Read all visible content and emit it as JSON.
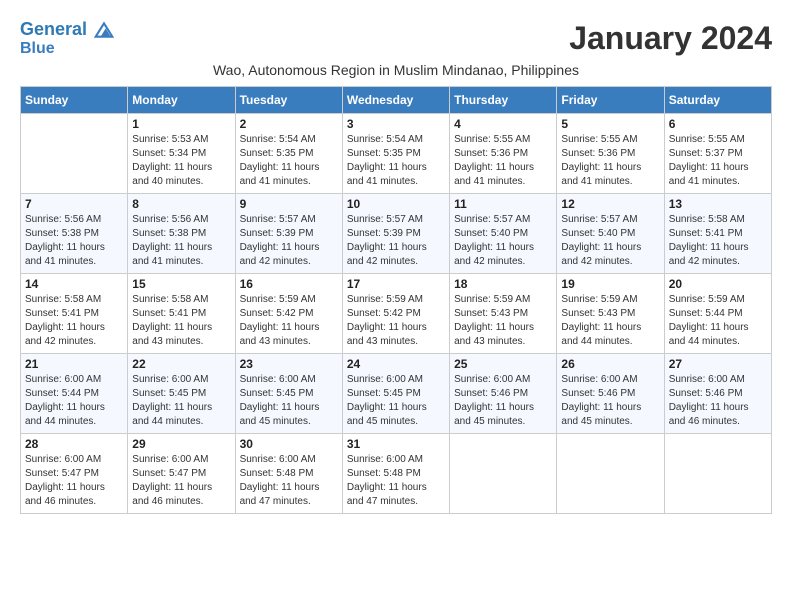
{
  "logo": {
    "line1": "General",
    "line2": "Blue"
  },
  "month_title": "January 2024",
  "subtitle": "Wao, Autonomous Region in Muslim Mindanao, Philippines",
  "weekdays": [
    "Sunday",
    "Monday",
    "Tuesday",
    "Wednesday",
    "Thursday",
    "Friday",
    "Saturday"
  ],
  "weeks": [
    [
      {
        "day": "",
        "info": ""
      },
      {
        "day": "1",
        "info": "Sunrise: 5:53 AM\nSunset: 5:34 PM\nDaylight: 11 hours\nand 40 minutes."
      },
      {
        "day": "2",
        "info": "Sunrise: 5:54 AM\nSunset: 5:35 PM\nDaylight: 11 hours\nand 41 minutes."
      },
      {
        "day": "3",
        "info": "Sunrise: 5:54 AM\nSunset: 5:35 PM\nDaylight: 11 hours\nand 41 minutes."
      },
      {
        "day": "4",
        "info": "Sunrise: 5:55 AM\nSunset: 5:36 PM\nDaylight: 11 hours\nand 41 minutes."
      },
      {
        "day": "5",
        "info": "Sunrise: 5:55 AM\nSunset: 5:36 PM\nDaylight: 11 hours\nand 41 minutes."
      },
      {
        "day": "6",
        "info": "Sunrise: 5:55 AM\nSunset: 5:37 PM\nDaylight: 11 hours\nand 41 minutes."
      }
    ],
    [
      {
        "day": "7",
        "info": "Sunrise: 5:56 AM\nSunset: 5:38 PM\nDaylight: 11 hours\nand 41 minutes."
      },
      {
        "day": "8",
        "info": "Sunrise: 5:56 AM\nSunset: 5:38 PM\nDaylight: 11 hours\nand 41 minutes."
      },
      {
        "day": "9",
        "info": "Sunrise: 5:57 AM\nSunset: 5:39 PM\nDaylight: 11 hours\nand 42 minutes."
      },
      {
        "day": "10",
        "info": "Sunrise: 5:57 AM\nSunset: 5:39 PM\nDaylight: 11 hours\nand 42 minutes."
      },
      {
        "day": "11",
        "info": "Sunrise: 5:57 AM\nSunset: 5:40 PM\nDaylight: 11 hours\nand 42 minutes."
      },
      {
        "day": "12",
        "info": "Sunrise: 5:57 AM\nSunset: 5:40 PM\nDaylight: 11 hours\nand 42 minutes."
      },
      {
        "day": "13",
        "info": "Sunrise: 5:58 AM\nSunset: 5:41 PM\nDaylight: 11 hours\nand 42 minutes."
      }
    ],
    [
      {
        "day": "14",
        "info": "Sunrise: 5:58 AM\nSunset: 5:41 PM\nDaylight: 11 hours\nand 42 minutes."
      },
      {
        "day": "15",
        "info": "Sunrise: 5:58 AM\nSunset: 5:41 PM\nDaylight: 11 hours\nand 43 minutes."
      },
      {
        "day": "16",
        "info": "Sunrise: 5:59 AM\nSunset: 5:42 PM\nDaylight: 11 hours\nand 43 minutes."
      },
      {
        "day": "17",
        "info": "Sunrise: 5:59 AM\nSunset: 5:42 PM\nDaylight: 11 hours\nand 43 minutes."
      },
      {
        "day": "18",
        "info": "Sunrise: 5:59 AM\nSunset: 5:43 PM\nDaylight: 11 hours\nand 43 minutes."
      },
      {
        "day": "19",
        "info": "Sunrise: 5:59 AM\nSunset: 5:43 PM\nDaylight: 11 hours\nand 44 minutes."
      },
      {
        "day": "20",
        "info": "Sunrise: 5:59 AM\nSunset: 5:44 PM\nDaylight: 11 hours\nand 44 minutes."
      }
    ],
    [
      {
        "day": "21",
        "info": "Sunrise: 6:00 AM\nSunset: 5:44 PM\nDaylight: 11 hours\nand 44 minutes."
      },
      {
        "day": "22",
        "info": "Sunrise: 6:00 AM\nSunset: 5:45 PM\nDaylight: 11 hours\nand 44 minutes."
      },
      {
        "day": "23",
        "info": "Sunrise: 6:00 AM\nSunset: 5:45 PM\nDaylight: 11 hours\nand 45 minutes."
      },
      {
        "day": "24",
        "info": "Sunrise: 6:00 AM\nSunset: 5:45 PM\nDaylight: 11 hours\nand 45 minutes."
      },
      {
        "day": "25",
        "info": "Sunrise: 6:00 AM\nSunset: 5:46 PM\nDaylight: 11 hours\nand 45 minutes."
      },
      {
        "day": "26",
        "info": "Sunrise: 6:00 AM\nSunset: 5:46 PM\nDaylight: 11 hours\nand 45 minutes."
      },
      {
        "day": "27",
        "info": "Sunrise: 6:00 AM\nSunset: 5:46 PM\nDaylight: 11 hours\nand 46 minutes."
      }
    ],
    [
      {
        "day": "28",
        "info": "Sunrise: 6:00 AM\nSunset: 5:47 PM\nDaylight: 11 hours\nand 46 minutes."
      },
      {
        "day": "29",
        "info": "Sunrise: 6:00 AM\nSunset: 5:47 PM\nDaylight: 11 hours\nand 46 minutes."
      },
      {
        "day": "30",
        "info": "Sunrise: 6:00 AM\nSunset: 5:48 PM\nDaylight: 11 hours\nand 47 minutes."
      },
      {
        "day": "31",
        "info": "Sunrise: 6:00 AM\nSunset: 5:48 PM\nDaylight: 11 hours\nand 47 minutes."
      },
      {
        "day": "",
        "info": ""
      },
      {
        "day": "",
        "info": ""
      },
      {
        "day": "",
        "info": ""
      }
    ]
  ]
}
